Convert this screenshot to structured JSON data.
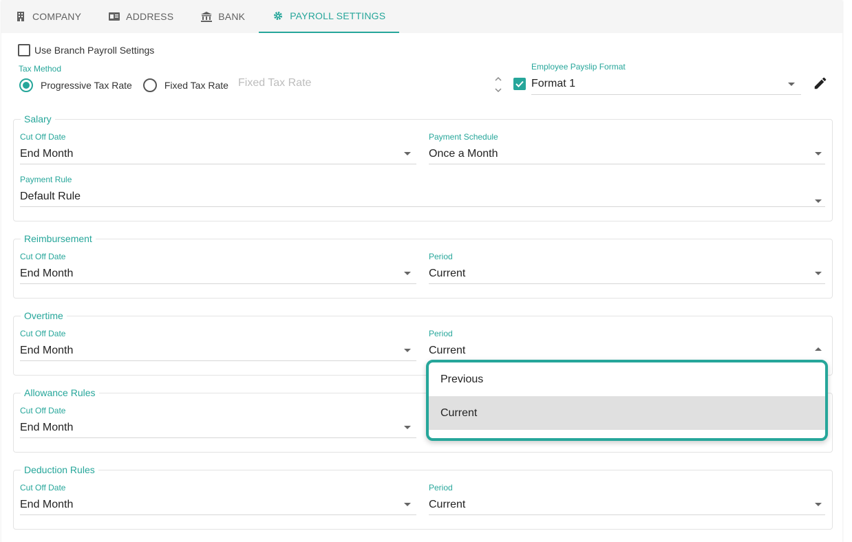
{
  "tabs": [
    {
      "label": "COMPANY",
      "icon": "building-icon"
    },
    {
      "label": "ADDRESS",
      "icon": "id-card-icon"
    },
    {
      "label": "BANK",
      "icon": "bank-icon"
    },
    {
      "label": "PAYROLL SETTINGS",
      "icon": "gear-icon",
      "active": true
    }
  ],
  "branch_checkbox": {
    "label": "Use Branch Payroll Settings",
    "checked": false
  },
  "tax_method": {
    "label": "Tax Method",
    "options": [
      "Progressive Tax Rate",
      "Fixed Tax Rate"
    ],
    "selected": "Progressive Tax Rate",
    "fixed_rate_placeholder": "Fixed Tax Rate"
  },
  "payslip": {
    "label": "Employee Payslip Format",
    "value": "Format 1",
    "checked": true
  },
  "salary": {
    "title": "Salary",
    "cutoff_label": "Cut Off Date",
    "cutoff_value": "End Month",
    "schedule_label": "Payment Schedule",
    "schedule_value": "Once a Month",
    "rule_label": "Payment Rule",
    "rule_value": "Default Rule"
  },
  "reimbursement": {
    "title": "Reimbursement",
    "cutoff_label": "Cut Off Date",
    "cutoff_value": "End Month",
    "period_label": "Period",
    "period_value": "Current"
  },
  "overtime": {
    "title": "Overtime",
    "cutoff_label": "Cut Off Date",
    "cutoff_value": "End Month",
    "period_label": "Period",
    "period_value": "Current"
  },
  "allowance": {
    "title": "Allowance Rules",
    "cutoff_label": "Cut Off Date",
    "cutoff_value": "End Month"
  },
  "deduction": {
    "title": "Deduction Rules",
    "cutoff_label": "Cut Off Date",
    "cutoff_value": "End Month",
    "period_label": "Period",
    "period_value": "Current"
  },
  "period_dropdown": {
    "options": [
      "Previous",
      "Current"
    ],
    "selected": "Current"
  },
  "colors": {
    "accent": "#26a69a",
    "selected_bg": "#e0e0e0"
  }
}
